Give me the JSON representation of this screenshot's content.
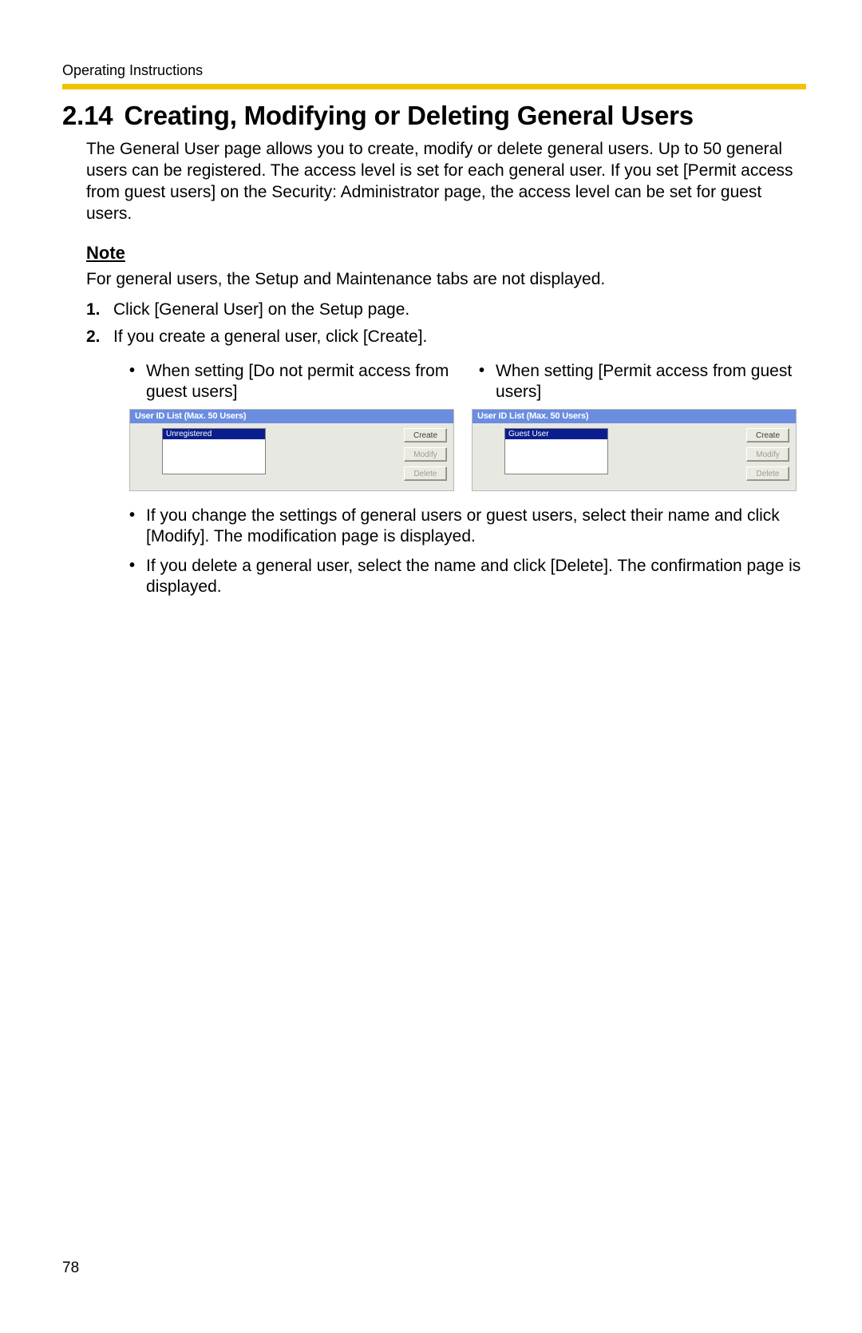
{
  "header_label": "Operating Instructions",
  "section_number": "2.14",
  "section_title": "Creating, Modifying or Deleting General Users",
  "intro": "The General User page allows you to create, modify or delete general users. Up to 50 general users can be registered. The access level is set for each general user. If you set [Permit access from guest users] on the Security: Administrator page, the access level can be set for guest users.",
  "note_heading": "Note",
  "note_body": "For general users, the Setup and Maintenance tabs are not displayed.",
  "steps": [
    "Click [General User] on the Setup page.",
    "If you create a general user, click [Create]."
  ],
  "scenario_labels": {
    "left": "When setting [Do not permit access from guest users]",
    "right": "When setting [Permit access from guest users]"
  },
  "panel": {
    "title": "User ID List (Max. 50 Users)",
    "left_item": "Unregistered",
    "right_item": "Guest User",
    "buttons": {
      "create": "Create",
      "modify": "Modify",
      "delete": "Delete"
    }
  },
  "post_bullets": [
    "If you change the settings of general users or guest users, select their name and click [Modify]. The modification page is displayed.",
    "If you delete a general user, select the name and click [Delete]. The confirmation page is displayed."
  ],
  "page_number": "78"
}
